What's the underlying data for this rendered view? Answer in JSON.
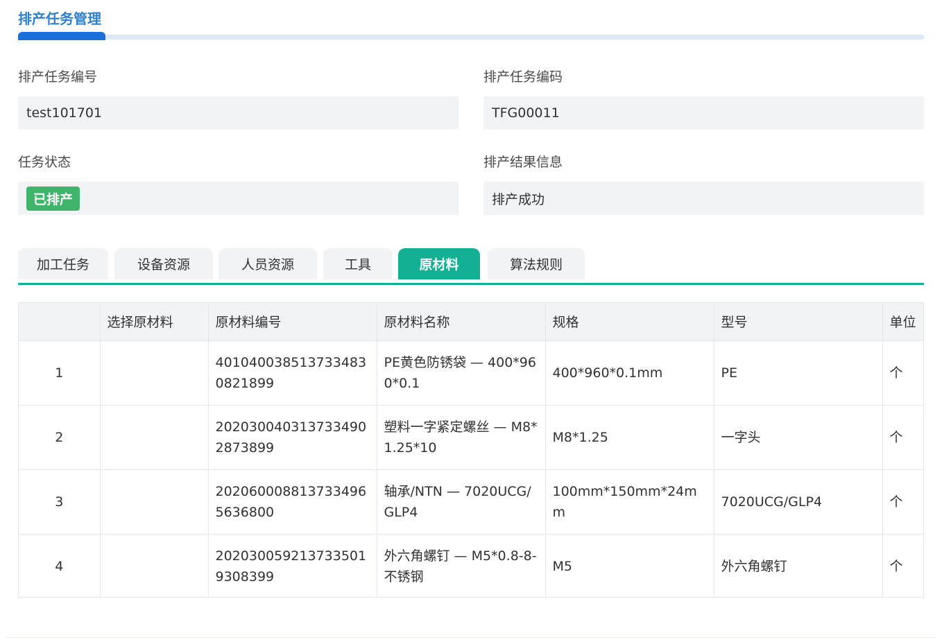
{
  "page": {
    "title": "排产任务管理"
  },
  "form": {
    "task_no_label": "排产任务编号",
    "task_no_value": "test101701",
    "task_code_label": "排产任务编码",
    "task_code_value": "TFG00011",
    "status_label": "任务状态",
    "status_value": "已排产",
    "result_label": "排产结果信息",
    "result_value": "排产成功"
  },
  "tabs": [
    {
      "label": "加工任务"
    },
    {
      "label": "设备资源"
    },
    {
      "label": "人员资源"
    },
    {
      "label": "工具"
    },
    {
      "label": "原材料",
      "active": true
    },
    {
      "label": "算法规则"
    }
  ],
  "table": {
    "headers": [
      "",
      "选择原材料",
      "原材料编号",
      "原材料名称",
      "规格",
      "型号",
      "单位"
    ],
    "rows": [
      {
        "index": "1",
        "select": "",
        "code": "4010400385137334830821899",
        "name": "PE黄色防锈袋 — 400*960*0.1",
        "spec": "400*960*0.1mm",
        "model": "PE",
        "unit": "个"
      },
      {
        "index": "2",
        "select": "",
        "code": "2020300403137334902873899",
        "name": "塑料一字紧定螺丝 — M8*1.25*10",
        "spec": "M8*1.25",
        "model": "一字头",
        "unit": "个"
      },
      {
        "index": "3",
        "select": "",
        "code": "2020600088137334965636800",
        "name": "轴承/NTN — 7020UCG/GLP4",
        "spec": "100mm*150mm*24mm",
        "model": "7020UCG/GLP4",
        "unit": "个"
      },
      {
        "index": "4",
        "select": "",
        "code": "2020300592137335019308399",
        "name": "外六角螺钉 — M5*0.8-8-不锈钢",
        "spec": "M5",
        "model": "外六角螺钉",
        "unit": "个"
      }
    ]
  },
  "colors": {
    "accent": "#13b094",
    "title": "#2f7fd0",
    "status": "#3fb56a"
  }
}
